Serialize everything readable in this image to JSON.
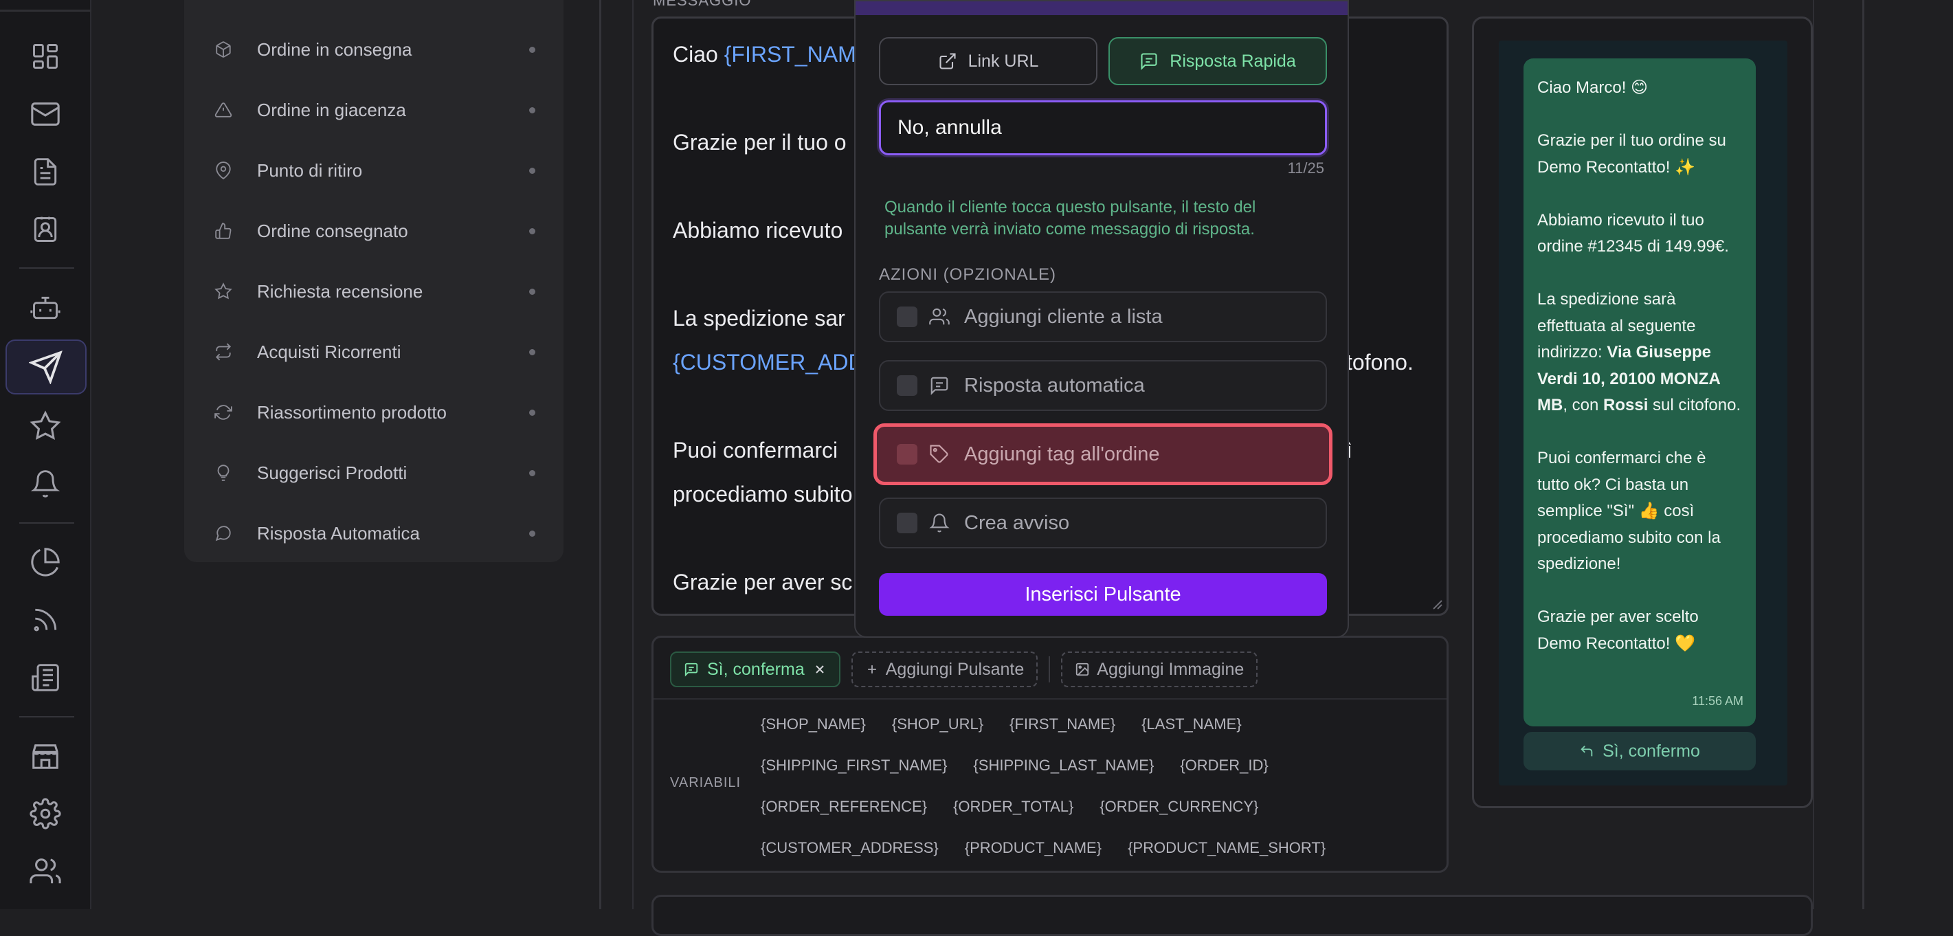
{
  "sidebar_list": {
    "items": [
      {
        "label": "Ordine in consegna",
        "icon": "package-icon"
      },
      {
        "label": "Ordine in giacenza",
        "icon": "warning-icon"
      },
      {
        "label": "Punto di ritiro",
        "icon": "map-pin-icon"
      },
      {
        "label": "Ordine consegnato",
        "icon": "thumbs-up-icon"
      },
      {
        "label": "Richiesta recensione",
        "icon": "star-icon"
      },
      {
        "label": "Acquisti Ricorrenti",
        "icon": "repeat-icon"
      },
      {
        "label": "Riassortimento prodotto",
        "icon": "refresh-icon"
      },
      {
        "label": "Suggerisci Prodotti",
        "icon": "lightbulb-icon"
      },
      {
        "label": "Risposta Automatica",
        "icon": "chat-bubble-icon"
      }
    ]
  },
  "editor": {
    "heading": "MESSAGGIO",
    "line1_prefix": "Ciao ",
    "line1_var": "{FIRST_NAM",
    "line2": "Grazie per il tuo o",
    "line3": "Abbiamo ricevuto",
    "line4": "La spedizione sar",
    "line5_var": "{CUSTOMER_ADD",
    "line5_suffix": "tofono.",
    "line6": "Puoi confermarci",
    "line6_suffix": "ì",
    "line7": "procediamo subito",
    "line8": "Grazie per aver sc"
  },
  "buttons_area": {
    "confirm_chip": "Sì, conferma",
    "add_button": "Aggiungi Pulsante",
    "add_image": "Aggiungi Immagine",
    "variables_label": "VARIABILI",
    "variables": [
      [
        "{SHOP_NAME}",
        "{SHOP_URL}",
        "{FIRST_NAME}",
        "{LAST_NAME}"
      ],
      [
        "{SHIPPING_FIRST_NAME}",
        "{SHIPPING_LAST_NAME}",
        "{ORDER_ID}"
      ],
      [
        "{ORDER_REFERENCE}",
        "{ORDER_TOTAL}",
        "{ORDER_CURRENCY}"
      ],
      [
        "{CUSTOMER_ADDRESS}",
        "{PRODUCT_NAME}",
        "{PRODUCT_NAME_SHORT}"
      ]
    ]
  },
  "preview": {
    "greeting": "Ciao Marco! 😊",
    "p2": "Grazie per il tuo ordine su Demo Recontatto! ✨",
    "p3": "Abbiamo ricevuto il tuo ordine #12345 di 149.99€.",
    "p4_a": "La spedizione sarà effettuata al seguente indirizzo: ",
    "p4_address": "Via Giuseppe Verdi 10, 20100 MONZA MB",
    "p4_b": ", con ",
    "p4_name": "Rossi",
    "p4_c": " sul citofono.",
    "p5": "Puoi confermarci che è tutto ok? Ci basta un semplice \"Sì\" 👍 così procediamo subito con la spedizione!",
    "p6": "Grazie per aver scelto Demo Recontatto! 💛",
    "time": "11:56 AM",
    "reply_button": "Sì, confermo"
  },
  "modal": {
    "type_link": "Link URL",
    "type_quick": "Risposta Rapida",
    "input_value": "No, annulla",
    "char_count": "11/25",
    "help_text": "Quando il cliente tocca questo pulsante, il testo del pulsante verrà inviato come messaggio di risposta.",
    "actions_label": "AZIONI (OPZIONALE)",
    "actions": [
      {
        "label": "Aggiungi cliente a lista",
        "icon": "users-icon"
      },
      {
        "label": "Risposta automatica",
        "icon": "message-reply-icon"
      },
      {
        "label": "Aggiungi tag all'ordine",
        "icon": "tag-icon"
      },
      {
        "label": "Crea avviso",
        "icon": "bell-icon"
      }
    ],
    "insert_button": "Inserisci Pulsante"
  },
  "colors": {
    "accent_purple": "#7c22f0",
    "quick_reply_green": "#7ee2a8",
    "highlight_red": "#f0596a",
    "whatsapp_bubble": "#236049"
  }
}
